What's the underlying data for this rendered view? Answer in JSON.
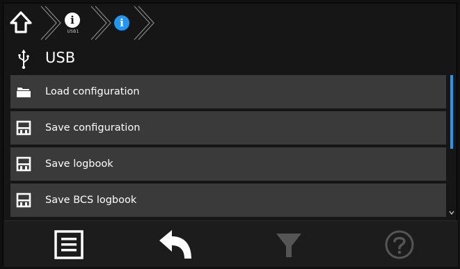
{
  "breadcrumb": {
    "home_icon": "home-icon",
    "items": [
      {
        "icon": "info-icon",
        "sublabel": "USB1"
      },
      {
        "icon": "info-icon",
        "sublabel": ""
      }
    ],
    "active_color": "#2196f3"
  },
  "title": {
    "icon": "usb-icon",
    "text": "USB"
  },
  "list": {
    "items": [
      {
        "icon": "folder-open-icon",
        "label": "Load configuration"
      },
      {
        "icon": "floppy-icon",
        "label": "Save configuration"
      },
      {
        "icon": "floppy-icon",
        "label": "Save logbook"
      },
      {
        "icon": "floppy-icon",
        "label": "Save BCS logbook"
      }
    ],
    "scroll_position": 0.0,
    "scroll_visible_fraction": 0.5
  },
  "footer": {
    "buttons": [
      {
        "icon": "menu-list-icon",
        "enabled": true
      },
      {
        "icon": "back-arrow-icon",
        "enabled": true
      },
      {
        "icon": "filter-icon",
        "enabled": false
      },
      {
        "icon": "help-icon",
        "enabled": false
      }
    ]
  },
  "colors": {
    "background": "#161616",
    "list_item": "#3a3a3a",
    "accent": "#2196f3",
    "disabled": "#555555"
  }
}
